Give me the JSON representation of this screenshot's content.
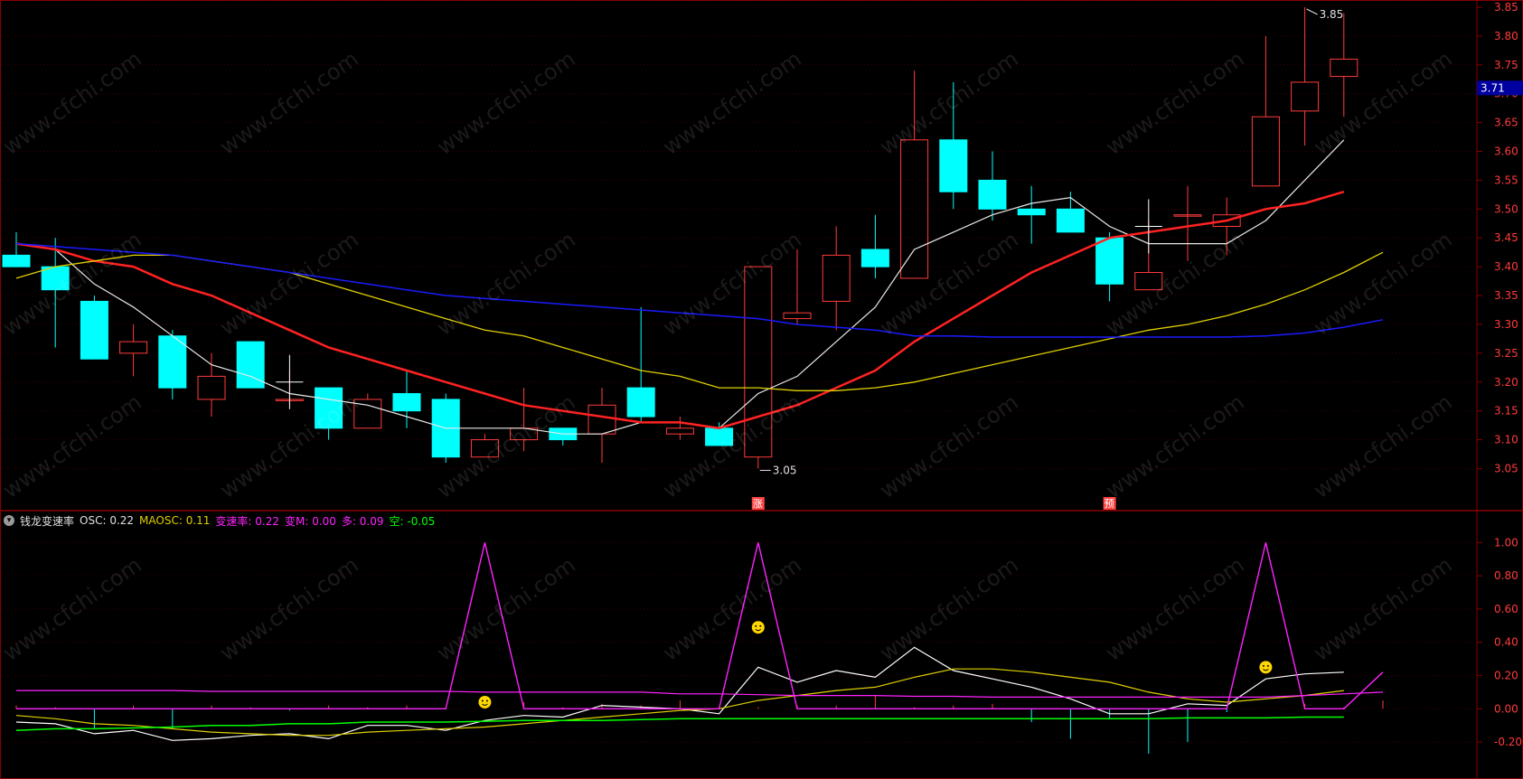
{
  "colors": {
    "background": "#000000",
    "frame": "#8b0000",
    "axis_text": "#ff3b3b",
    "up": "#ff3b3b",
    "down": "#00ffff",
    "ma5": "#e8e8e8",
    "ma10": "#ff2222",
    "ma20": "#e0d000",
    "ma60": "#1a1aff",
    "osc": "#ffffff",
    "maosc": "#e0d000",
    "rate": "#ff22ff",
    "rate_m": "#ff22ff",
    "bull": "#ff22ff",
    "bear": "#00ff00",
    "current_price_bg": "#0000a0",
    "signal_bg": "#ff4444"
  },
  "watermark_text": "www.cfchi.com",
  "indicator_header": {
    "collapse_icon": "chevron-down-icon",
    "name": "钱龙变速率",
    "osc": "OSC: 0.22",
    "maosc": "MAOSC: 0.11",
    "rate": "变速率: 0.22",
    "rate_m": "变M: 0.00",
    "bull": "多: 0.09",
    "bear": "空: -0.05"
  },
  "chart_data": [
    {
      "type": "candlestick",
      "title": "",
      "ylim": [
        3.01,
        3.85
      ],
      "y_ticks": [
        "3.05",
        "3.10",
        "3.15",
        "3.20",
        "3.25",
        "3.30",
        "3.35",
        "3.40",
        "3.45",
        "3.50",
        "3.55",
        "3.60",
        "3.65",
        "3.70",
        "3.75",
        "3.80",
        "3.85"
      ],
      "current_price": "3.71",
      "high_label": "3.85",
      "low_label": "3.05",
      "signal_markers": [
        {
          "index": 19,
          "label": "涨"
        },
        {
          "index": 28,
          "label": "预"
        }
      ],
      "candles": [
        {
          "o": 3.42,
          "h": 3.46,
          "l": 3.4,
          "c": 3.4
        },
        {
          "o": 3.4,
          "h": 3.45,
          "l": 3.26,
          "c": 3.36
        },
        {
          "o": 3.34,
          "h": 3.35,
          "l": 3.24,
          "c": 3.24
        },
        {
          "o": 3.25,
          "h": 3.3,
          "l": 3.21,
          "c": 3.27
        },
        {
          "o": 3.28,
          "h": 3.29,
          "l": 3.17,
          "c": 3.19
        },
        {
          "o": 3.17,
          "h": 3.25,
          "l": 3.14,
          "c": 3.21
        },
        {
          "o": 3.27,
          "h": 3.27,
          "l": 3.19,
          "c": 3.19
        },
        {
          "o": 3.17,
          "h": 3.22,
          "l": 3.16,
          "c": 3.17
        },
        {
          "o": 3.19,
          "h": 3.19,
          "l": 3.1,
          "c": 3.12
        },
        {
          "o": 3.12,
          "h": 3.18,
          "l": 3.12,
          "c": 3.17
        },
        {
          "o": 3.18,
          "h": 3.22,
          "l": 3.12,
          "c": 3.15
        },
        {
          "o": 3.17,
          "h": 3.18,
          "l": 3.06,
          "c": 3.07
        },
        {
          "o": 3.07,
          "h": 3.11,
          "l": 3.07,
          "c": 3.1
        },
        {
          "o": 3.1,
          "h": 3.19,
          "l": 3.08,
          "c": 3.12
        },
        {
          "o": 3.12,
          "h": 3.12,
          "l": 3.09,
          "c": 3.1
        },
        {
          "o": 3.11,
          "h": 3.19,
          "l": 3.06,
          "c": 3.16
        },
        {
          "o": 3.19,
          "h": 3.33,
          "l": 3.13,
          "c": 3.14
        },
        {
          "o": 3.11,
          "h": 3.14,
          "l": 3.1,
          "c": 3.12
        },
        {
          "o": 3.12,
          "h": 3.13,
          "l": 3.09,
          "c": 3.09
        },
        {
          "o": 3.07,
          "h": 3.4,
          "l": 3.05,
          "c": 3.4
        },
        {
          "o": 3.31,
          "h": 3.43,
          "l": 3.3,
          "c": 3.32
        },
        {
          "o": 3.34,
          "h": 3.47,
          "l": 3.29,
          "c": 3.42
        },
        {
          "o": 3.43,
          "h": 3.49,
          "l": 3.38,
          "c": 3.4
        },
        {
          "o": 3.38,
          "h": 3.74,
          "l": 3.38,
          "c": 3.62
        },
        {
          "o": 3.62,
          "h": 3.72,
          "l": 3.5,
          "c": 3.53
        },
        {
          "o": 3.55,
          "h": 3.6,
          "l": 3.48,
          "c": 3.5
        },
        {
          "o": 3.5,
          "h": 3.54,
          "l": 3.44,
          "c": 3.49
        },
        {
          "o": 3.5,
          "h": 3.53,
          "l": 3.46,
          "c": 3.46
        },
        {
          "o": 3.45,
          "h": 3.46,
          "l": 3.34,
          "c": 3.37
        },
        {
          "o": 3.36,
          "h": 3.48,
          "l": 3.36,
          "c": 3.39
        },
        {
          "o": 3.49,
          "h": 3.54,
          "l": 3.41,
          "c": 3.49
        },
        {
          "o": 3.47,
          "h": 3.52,
          "l": 3.42,
          "c": 3.49
        },
        {
          "o": 3.54,
          "h": 3.8,
          "l": 3.54,
          "c": 3.66
        },
        {
          "o": 3.67,
          "h": 3.85,
          "l": 3.61,
          "c": 3.72
        },
        {
          "o": 3.73,
          "h": 3.84,
          "l": 3.66,
          "c": 3.76
        }
      ],
      "series": [
        {
          "key": "ma5",
          "values": [
            3.44,
            3.43,
            3.37,
            3.33,
            3.28,
            3.23,
            3.21,
            3.18,
            3.17,
            3.16,
            3.14,
            3.12,
            3.12,
            3.12,
            3.11,
            3.11,
            3.13,
            3.13,
            3.12,
            3.18,
            3.21,
            3.27,
            3.33,
            3.43,
            3.46,
            3.49,
            3.51,
            3.52,
            3.47,
            3.44,
            3.44,
            3.44,
            3.48,
            3.55,
            3.62
          ]
        },
        {
          "key": "ma10",
          "values": [
            3.44,
            3.43,
            3.41,
            3.4,
            3.37,
            3.35,
            3.32,
            3.29,
            3.26,
            3.24,
            3.22,
            3.2,
            3.18,
            3.16,
            3.15,
            3.14,
            3.13,
            3.13,
            3.12,
            3.14,
            3.16,
            3.19,
            3.22,
            3.27,
            3.31,
            3.35,
            3.39,
            3.42,
            3.45,
            3.46,
            3.47,
            3.48,
            3.5,
            3.51,
            3.53
          ]
        },
        {
          "key": "ma20",
          "values": [
            3.38,
            3.4,
            3.41,
            3.42,
            3.42,
            3.41,
            3.4,
            3.39,
            3.37,
            3.35,
            3.33,
            3.31,
            3.29,
            3.28,
            3.26,
            3.24,
            3.22,
            3.21,
            3.19,
            3.19,
            3.185,
            3.185,
            3.19,
            3.2,
            3.215,
            3.23,
            3.245,
            3.26,
            3.275,
            3.29,
            3.3,
            3.315,
            3.335,
            3.36,
            3.39,
            3.425
          ]
        },
        {
          "key": "ma60",
          "values": [
            3.44,
            3.435,
            3.43,
            3.425,
            3.42,
            3.41,
            3.4,
            3.39,
            3.38,
            3.37,
            3.36,
            3.35,
            3.345,
            3.34,
            3.335,
            3.33,
            3.325,
            3.32,
            3.315,
            3.31,
            3.3,
            3.295,
            3.29,
            3.28,
            3.28,
            3.278,
            3.278,
            3.278,
            3.278,
            3.278,
            3.278,
            3.278,
            3.28,
            3.285,
            3.295,
            3.308
          ]
        }
      ]
    },
    {
      "type": "line",
      "title": "钱龙变速率",
      "ylim": [
        -0.33,
        1.1
      ],
      "y_ticks": [
        "-0.20",
        "0.00",
        "0.20",
        "0.40",
        "0.60",
        "0.80",
        "1.00"
      ],
      "histogram": [
        0.02,
        0.01,
        -0.12,
        0.02,
        -0.12,
        0.02,
        0.01,
        -0.01,
        0.02,
        0.01,
        0.02,
        0.01,
        0.02,
        0.04,
        0.01,
        0.03,
        0.02,
        0.05,
        0.01,
        0.01,
        0.02,
        0.02,
        0.08,
        0.01,
        0.02,
        0.03,
        -0.08,
        -0.18,
        -0.06,
        -0.27,
        -0.2,
        -0.02,
        0.0,
        0.03,
        0.01,
        0.05
      ],
      "smile_markers": [
        {
          "index": 12,
          "value": 0.04
        },
        {
          "index": 19,
          "value": 0.49
        },
        {
          "index": 32,
          "value": 0.25
        }
      ],
      "series": [
        {
          "key": "osc",
          "name": "OSC",
          "values": [
            -0.08,
            -0.09,
            -0.15,
            -0.13,
            -0.19,
            -0.18,
            -0.16,
            -0.15,
            -0.18,
            -0.1,
            -0.1,
            -0.13,
            -0.07,
            -0.04,
            -0.05,
            0.02,
            0.01,
            0.0,
            -0.03,
            0.25,
            0.16,
            0.23,
            0.19,
            0.37,
            0.23,
            0.18,
            0.13,
            0.06,
            -0.03,
            -0.03,
            0.03,
            0.02,
            0.18,
            0.21,
            0.22
          ]
        },
        {
          "key": "maosc",
          "name": "MAOSC",
          "values": [
            -0.04,
            -0.06,
            -0.09,
            -0.1,
            -0.12,
            -0.14,
            -0.15,
            -0.16,
            -0.16,
            -0.14,
            -0.13,
            -0.12,
            -0.11,
            -0.09,
            -0.07,
            -0.05,
            -0.03,
            -0.01,
            0.0,
            0.05,
            0.08,
            0.11,
            0.13,
            0.19,
            0.24,
            0.24,
            0.22,
            0.19,
            0.16,
            0.1,
            0.06,
            0.04,
            0.06,
            0.08,
            0.11
          ]
        },
        {
          "key": "rate",
          "name": "变速率",
          "values": [
            0.0,
            0.0,
            0.0,
            0.0,
            0.0,
            0.0,
            0.0,
            0.0,
            0.0,
            0.0,
            0.0,
            0.0,
            1.0,
            0.0,
            0.0,
            0.0,
            0.0,
            0.0,
            0.0,
            1.0,
            0.0,
            0.0,
            0.0,
            0.0,
            0.0,
            0.0,
            0.0,
            0.0,
            0.0,
            0.0,
            0.0,
            0.0,
            1.0,
            0.0,
            0.0,
            0.22
          ]
        },
        {
          "key": "rate_m",
          "name": "变M",
          "values": [
            0.11,
            0.11,
            0.11,
            0.11,
            0.11,
            0.105,
            0.105,
            0.105,
            0.105,
            0.105,
            0.105,
            0.105,
            0.1,
            0.1,
            0.1,
            0.1,
            0.1,
            0.09,
            0.09,
            0.085,
            0.08,
            0.08,
            0.08,
            0.075,
            0.075,
            0.07,
            0.07,
            0.07,
            0.07,
            0.07,
            0.07,
            0.07,
            0.07,
            0.08,
            0.09,
            0.1
          ]
        },
        {
          "key": "bear",
          "name": "空",
          "values": [
            -0.13,
            -0.12,
            -0.12,
            -0.115,
            -0.11,
            -0.1,
            -0.1,
            -0.09,
            -0.09,
            -0.08,
            -0.08,
            -0.08,
            -0.075,
            -0.07,
            -0.07,
            -0.07,
            -0.065,
            -0.06,
            -0.06,
            -0.06,
            -0.06,
            -0.06,
            -0.06,
            -0.06,
            -0.06,
            -0.06,
            -0.06,
            -0.06,
            -0.06,
            -0.06,
            -0.055,
            -0.055,
            -0.055,
            -0.05,
            -0.05
          ]
        }
      ]
    }
  ]
}
